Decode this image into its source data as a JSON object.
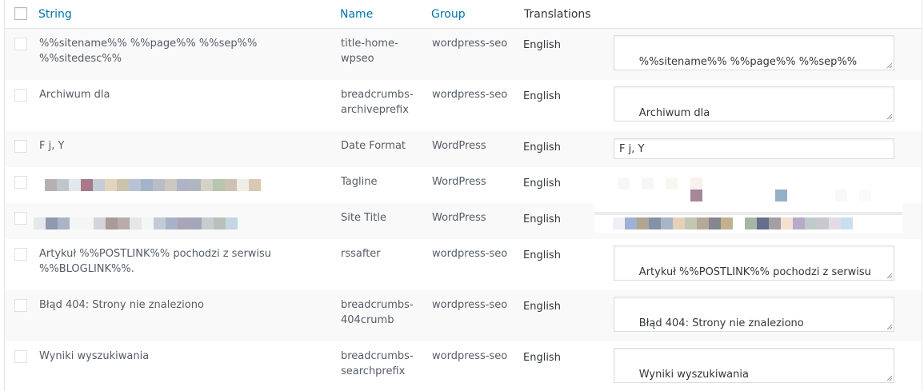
{
  "header": {
    "string_label": "String",
    "name_label": "Name",
    "group_label": "Group",
    "translations_label": "Translations"
  },
  "rows": [
    {
      "string": "%%sitename%% %%page%% %%sep%% %%sitedesc%%",
      "name": "title-home-\nwpseo",
      "group": "wordpress-seo",
      "language": "English",
      "translation": "%%sitename%% %%page%% %%sep%%\n%%sitedesc%%"
    },
    {
      "string": "Archiwum dla",
      "name": "breadcrumbs-\narchiveprefix",
      "group": "wordpress-seo",
      "language": "English",
      "translation": "Archiwum dla"
    },
    {
      "string": "F j, Y",
      "name": "Date Format",
      "group": "WordPress",
      "language": "English",
      "translation": "F j, Y"
    },
    {
      "string": "",
      "name": "Tagline",
      "group": "WordPress",
      "language": "English",
      "translation": ""
    },
    {
      "string": "",
      "name": "Site Title",
      "group": "WordPress",
      "language": "English",
      "translation": ""
    },
    {
      "string": "Artykuł %%POSTLINK%% pochodzi z serwisu\n%%BLOGLINK%%.",
      "name": "rssafter",
      "group": "wordpress-seo",
      "language": "English",
      "translation": "Artykuł %%POSTLINK%% pochodzi z serwisu\n%%BLOGLINK%%."
    },
    {
      "string": "Błąd 404: Strony nie znaleziono",
      "name": "breadcrumbs-\n404crumb",
      "group": "wordpress-seo",
      "language": "English",
      "translation": "Błąd 404: Strony nie znaleziono"
    },
    {
      "string": "Wyniki wyszukiwania",
      "name": "breadcrumbs-\nsearchprefix",
      "group": "wordpress-seo",
      "language": "English",
      "translation": "Wyniki wyszukiwania"
    }
  ],
  "colors": {
    "link": "#0073aa",
    "text": "#555d66",
    "alt_row": "#f9f9f9",
    "border": "#dddddd"
  }
}
